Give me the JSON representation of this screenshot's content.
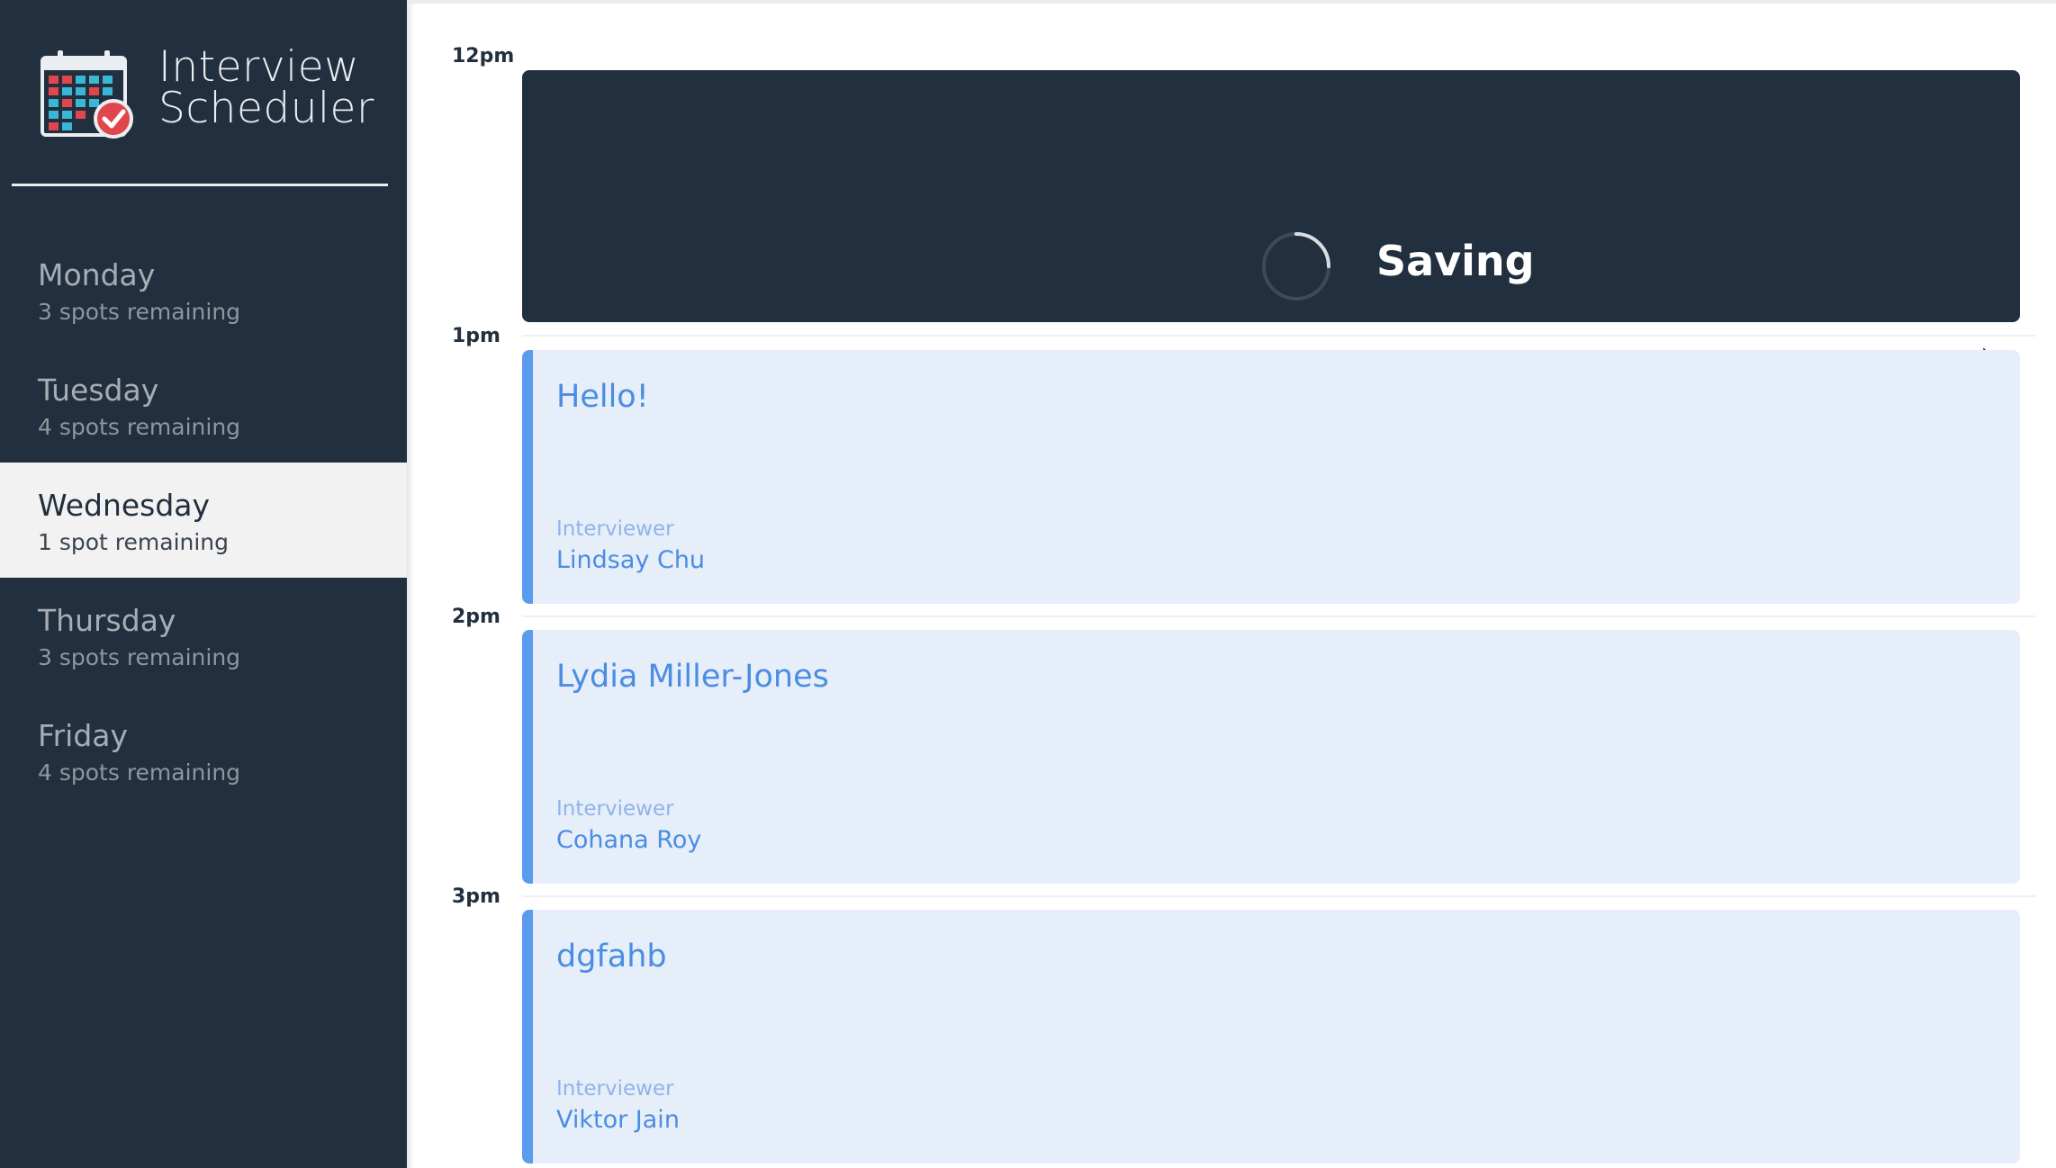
{
  "app": {
    "title_line1": "Interview",
    "title_line2": "Scheduler",
    "logo_icon": "calendar-check-icon"
  },
  "sidebar": {
    "days": [
      {
        "name": "Monday",
        "spots": "3 spots remaining",
        "selected": false
      },
      {
        "name": "Tuesday",
        "spots": "4 spots remaining",
        "selected": false
      },
      {
        "name": "Wednesday",
        "spots": "1 spot remaining",
        "selected": true
      },
      {
        "name": "Thursday",
        "spots": "3 spots remaining",
        "selected": false
      },
      {
        "name": "Friday",
        "spots": "4 spots remaining",
        "selected": false
      }
    ]
  },
  "schedule": {
    "times": [
      "12pm",
      "1pm",
      "2pm",
      "3pm"
    ],
    "status": {
      "text": "Saving",
      "icon": "spinner-icon"
    },
    "appointments": [
      {
        "student": "Hello!",
        "interviewer_label": "Interviewer",
        "interviewer": "Lindsay Chu"
      },
      {
        "student": "Lydia Miller-Jones",
        "interviewer_label": "Interviewer",
        "interviewer": "Cohana Roy"
      },
      {
        "student": "dgfahb",
        "interviewer_label": "Interviewer",
        "interviewer": "Viktor Jain"
      }
    ]
  },
  "colors": {
    "sidebar_bg": "#222f3e",
    "selected_day_bg": "#f2f2f2",
    "appointment_bg": "#e6eef9",
    "accent_blue": "#5b9bef"
  }
}
